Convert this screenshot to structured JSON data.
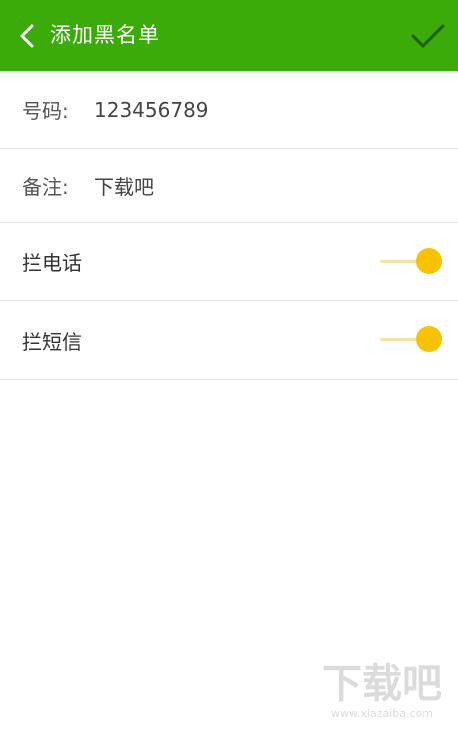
{
  "header": {
    "title": "添加黑名单",
    "back_icon": "chevron-left-icon",
    "confirm_icon": "checkmark-icon",
    "background": "#3aab08"
  },
  "form": {
    "number_label": "号码:",
    "number_value": "123456789",
    "note_label": "备注:",
    "note_value": "下载吧"
  },
  "toggles": [
    {
      "label": "拦电话",
      "on": true
    },
    {
      "label": "拦短信",
      "on": true
    }
  ],
  "colors": {
    "accent": "#3aab08",
    "toggle_on": "#f7c300"
  },
  "watermark": {
    "logo_text": "下载吧",
    "site": "www.xiazaiba.com"
  }
}
